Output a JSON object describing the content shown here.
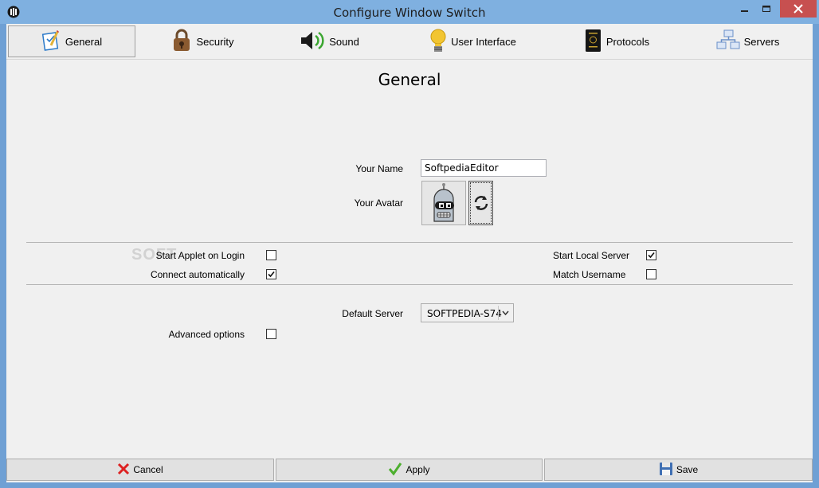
{
  "window": {
    "title": "Configure Window Switch"
  },
  "tabs": [
    {
      "label": "General",
      "icon": "checklist-icon",
      "active": true
    },
    {
      "label": "Security",
      "icon": "padlock-icon",
      "active": false
    },
    {
      "label": "Sound",
      "icon": "speaker-icon",
      "active": false
    },
    {
      "label": "User Interface",
      "icon": "lightbulb-icon",
      "active": false
    },
    {
      "label": "Protocols",
      "icon": "passport-icon",
      "active": false
    },
    {
      "label": "Servers",
      "icon": "network-icon",
      "active": false
    }
  ],
  "general": {
    "heading": "General",
    "your_name_label": "Your Name",
    "your_name_value": "SoftpediaEditor",
    "your_avatar_label": "Your Avatar",
    "start_applet_label": "Start Applet on Login",
    "start_applet_checked": false,
    "connect_auto_label": "Connect automatically",
    "connect_auto_checked": true,
    "start_local_label": "Start Local Server",
    "start_local_checked": true,
    "match_username_label": "Match Username",
    "match_username_checked": false,
    "default_server_label": "Default Server",
    "default_server_value": "SOFTPEDIA-S74",
    "advanced_label": "Advanced options",
    "advanced_checked": false
  },
  "footer": {
    "cancel_label": "Cancel",
    "apply_label": "Apply",
    "save_label": "Save"
  },
  "watermark": "SOFT"
}
